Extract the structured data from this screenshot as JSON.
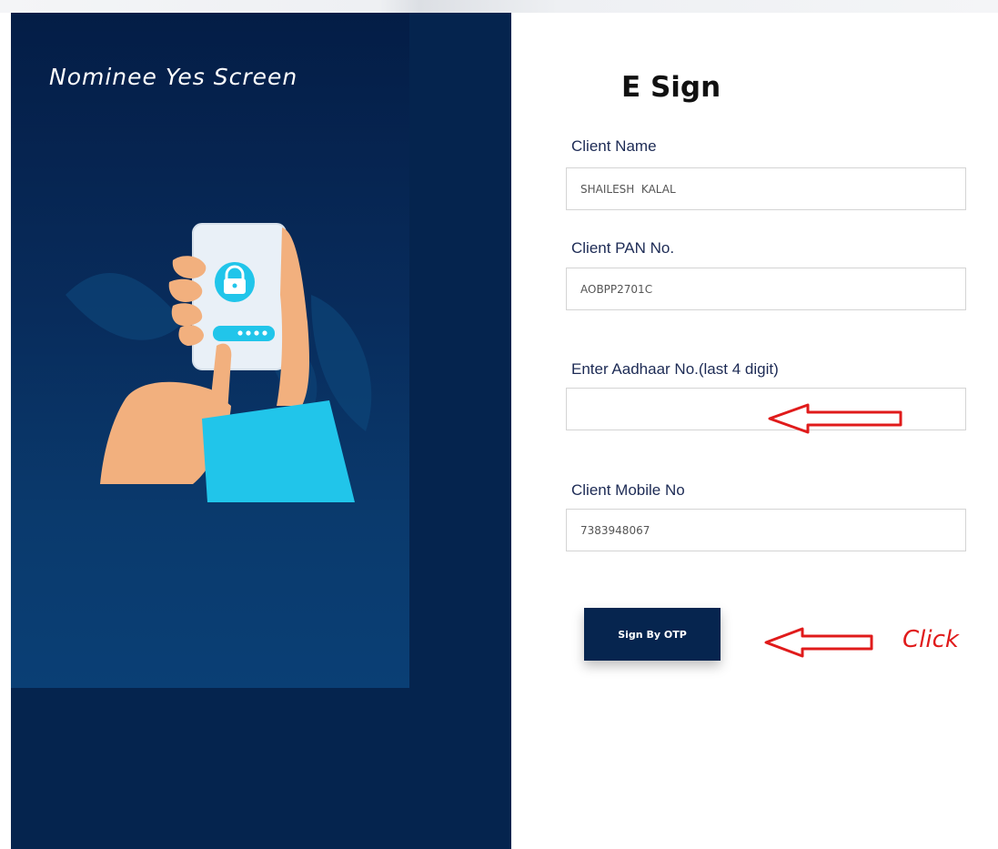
{
  "hero": {
    "title": "Nominee Yes Screen"
  },
  "form": {
    "title": "E Sign",
    "fields": [
      {
        "label": "Client Name",
        "value": "SHAILESH  KALAL"
      },
      {
        "label": "Client PAN No.",
        "value": "AOBPP2701C"
      },
      {
        "label": "Enter Aadhaar No.(last 4 digit)",
        "value": ""
      },
      {
        "label": "Client Mobile No",
        "value": "7383948067"
      }
    ],
    "submit_label": "Sign By OTP"
  },
  "annotation": {
    "click_text": "Click",
    "color": "#e01b1b"
  },
  "colors": {
    "navy": "#05244e",
    "skin": "#f2b07e",
    "cyan": "#21c5ea"
  },
  "icons": [
    "phone-lock-illustration",
    "lock-icon",
    "red-arrow-icon"
  ]
}
